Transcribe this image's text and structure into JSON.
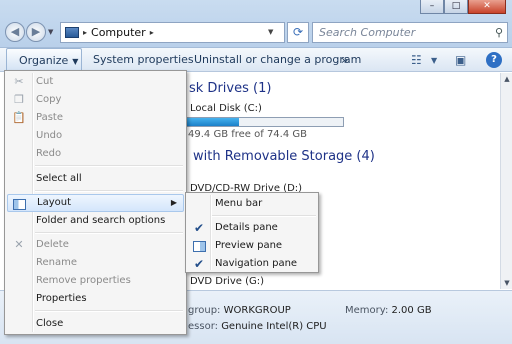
{
  "window": {
    "controls": [
      "–",
      "□",
      "✕"
    ]
  },
  "nav": {
    "back_icon": "back-arrow-icon",
    "forward_icon": "forward-arrow-icon"
  },
  "address": {
    "crumb": "Computer",
    "separator": "▸"
  },
  "search": {
    "placeholder": "Search Computer"
  },
  "toolbar": {
    "organize": "Organize",
    "system_properties": "System properties",
    "uninstall": "Uninstall or change a program",
    "more": "»"
  },
  "content": {
    "group1": "sk Drives (1)",
    "drive1_name": "Local Disk (C:)",
    "drive1_free": "49.4 GB free of 74.4 GB",
    "drive1_used_fraction": 0.336,
    "group2": "with Removable Storage (4)",
    "dev1": "DVD/CD-RW Drive (D:)",
    "dev2": "DVD Drive (G:)"
  },
  "details": {
    "workgroup_label": "group:",
    "workgroup_value": "WORKGROUP",
    "processor_label": "essor:",
    "processor_value": "Genuine Intel(R) CPU",
    "memory_label": "Memory:",
    "memory_value": "2.00 GB"
  },
  "organize_menu": {
    "cut": "Cut",
    "copy": "Copy",
    "paste": "Paste",
    "undo": "Undo",
    "redo": "Redo",
    "select_all": "Select all",
    "layout": "Layout",
    "folder_options": "Folder and search options",
    "delete": "Delete",
    "rename": "Rename",
    "remove_properties": "Remove properties",
    "properties": "Properties",
    "close": "Close"
  },
  "layout_submenu": {
    "menu_bar": "Menu bar",
    "details_pane": "Details pane",
    "preview_pane": "Preview pane",
    "navigation_pane": "Navigation pane",
    "checked": [
      "Details pane",
      "Navigation pane"
    ]
  }
}
